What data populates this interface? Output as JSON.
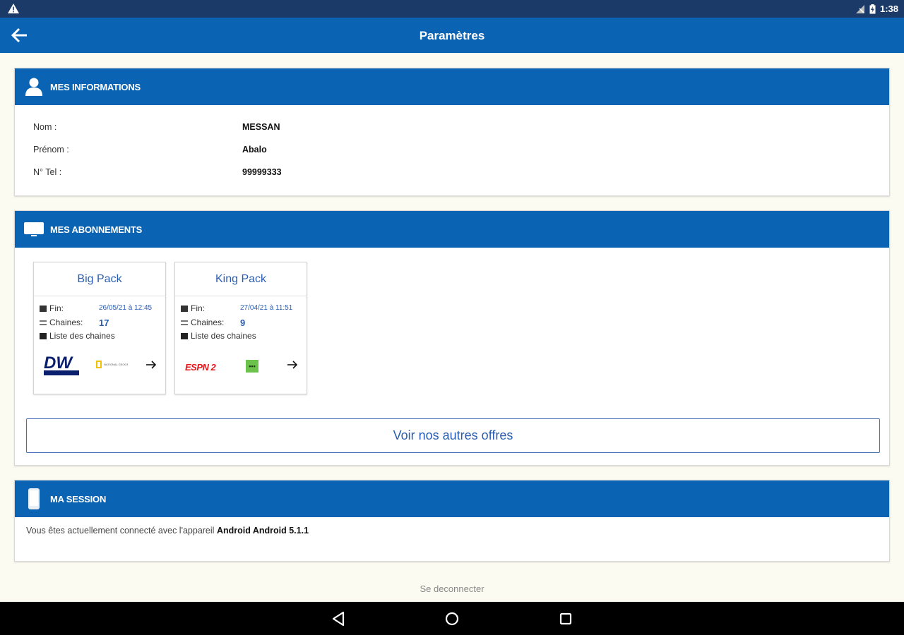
{
  "status_bar": {
    "time": "1:38"
  },
  "app_bar": {
    "title": "Paramètres"
  },
  "info_card": {
    "title": "MES INFORMATIONS",
    "rows": [
      {
        "label": "Nom :",
        "value": "MESSAN"
      },
      {
        "label": "Prénom :",
        "value": "Abalo"
      },
      {
        "label": "N° Tel :",
        "value": "99999333"
      }
    ]
  },
  "subs_card": {
    "title": "MES ABONNEMENTS",
    "packs": [
      {
        "name": "Big Pack",
        "fin_label": "Fin:",
        "fin_value": "26/05/21 à 12:45",
        "chaines_label": "Chaines:",
        "chaines_value": "17",
        "liste_label": "Liste des chaines",
        "logos": [
          "DW",
          "NATIONAL GEOGRAPHIC"
        ]
      },
      {
        "name": "King Pack",
        "fin_label": "Fin:",
        "fin_value": "27/04/21 à 11:51",
        "chaines_label": "Chaines:",
        "chaines_value": "9",
        "liste_label": "Liste des chaines",
        "logos": [
          "ESPN 2",
          "•••"
        ]
      }
    ],
    "offers_button": "Voir nos autres offres"
  },
  "session_card": {
    "title": "MA SESSION",
    "text_prefix": "Vous êtes actuellement connecté avec l'appareil",
    "device": "Android Android 5.1.1"
  },
  "logout_label": "Se deconnecter",
  "colors": {
    "primary": "#0a63b3",
    "status_bar": "#1c3a68",
    "accent_text": "#2a5db0",
    "background": "#fbfbf2"
  }
}
